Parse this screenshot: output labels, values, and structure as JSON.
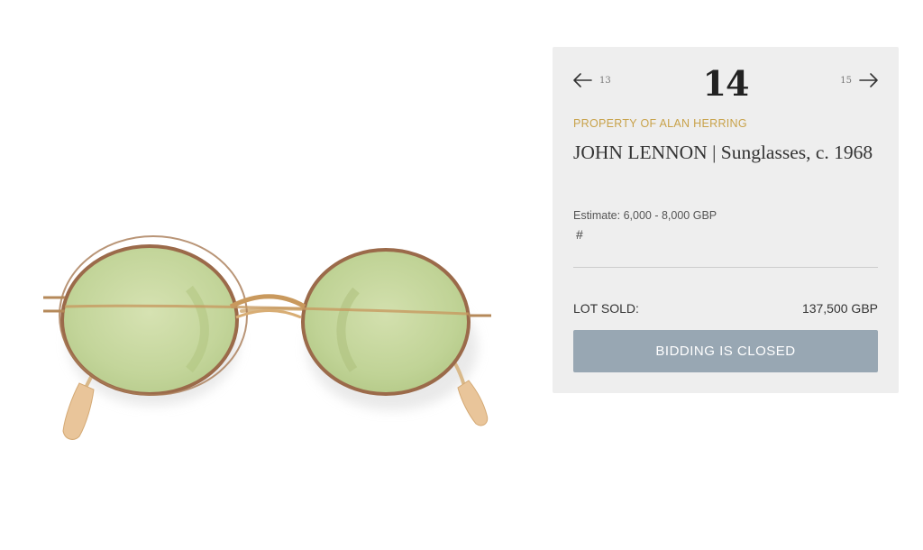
{
  "lot": {
    "prev_number": "13",
    "current_number": "14",
    "next_number": "15",
    "provenance": "PROPERTY OF ALAN HERRING",
    "title": "JOHN LENNON | Sunglasses, c. 1968",
    "estimate": "Estimate: 6,000 - 8,000 GBP",
    "hash_link": "#",
    "sold_label": "LOT SOLD:",
    "sold_value": "137,500 GBP",
    "bidding_button": "BIDDING IS CLOSED"
  },
  "icons": {
    "prev": "arrow-left-icon",
    "next": "arrow-right-icon"
  },
  "colors": {
    "panel_background": "#eeeeee",
    "provenance_gold": "#c8a24a",
    "button_background": "#98a7b3",
    "lens_green": "#c9d9a0",
    "frame_gold": "#b08a5a"
  }
}
